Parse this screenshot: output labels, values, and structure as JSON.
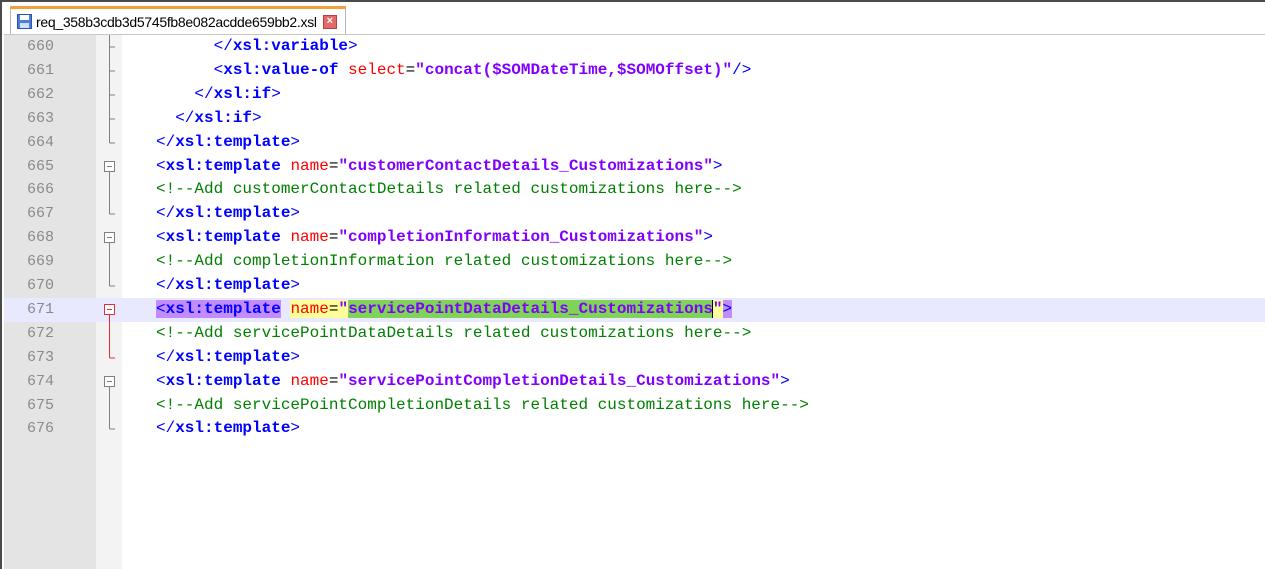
{
  "tab": {
    "filename": "req_358b3cdb3d5745fb8e082acdde659bb2.xsl"
  },
  "icons": {
    "file": "save-file-icon",
    "close": "close-icon",
    "fold_open": "fold-minus-icon"
  },
  "colors": {
    "tab_accent": "#f2a13a",
    "current_line": "#e8e8ff",
    "selection": "#7fd356",
    "tag_match": "#c28cff"
  },
  "lines": [
    {
      "num": "660",
      "indent": "      ",
      "parts": [
        [
          "t-tag",
          "&lt;/"
        ],
        [
          "t-el",
          "xsl:variable"
        ],
        [
          "t-tag",
          "&gt;"
        ]
      ]
    },
    {
      "num": "661",
      "indent": "      ",
      "parts": []
    },
    {
      "num": "662",
      "indent": "    ",
      "parts": []
    },
    {
      "num": "663",
      "indent": "  ",
      "parts": []
    },
    {
      "num": "664",
      "indent": "",
      "parts": []
    },
    {
      "num": "665",
      "indent": "",
      "parts": []
    },
    {
      "num": "666",
      "indent": "",
      "parts": []
    },
    {
      "num": "667",
      "indent": "",
      "parts": []
    },
    {
      "num": "668",
      "indent": "",
      "parts": []
    },
    {
      "num": "669",
      "indent": "",
      "parts": []
    },
    {
      "num": "670",
      "indent": "",
      "parts": []
    },
    {
      "num": "671",
      "indent": "",
      "parts": []
    },
    {
      "num": "672",
      "indent": "",
      "parts": []
    },
    {
      "num": "673",
      "indent": "",
      "parts": []
    },
    {
      "num": "674",
      "indent": "",
      "parts": []
    },
    {
      "num": "675",
      "indent": "",
      "parts": []
    },
    {
      "num": "676",
      "indent": "",
      "parts": []
    }
  ],
  "code": {
    "l660": "      </xsl:variable>",
    "l661": "      <xsl:value-of select=\"concat($SOMDateTime,$SOMOffset)\"/>",
    "l662": "    </xsl:if>",
    "l663": "  </xsl:if>",
    "l664": "</xsl:template>",
    "l665": "<xsl:template name=\"customerContactDetails_Customizations\">",
    "l666": "<!--Add customerContactDetails related customizations here-->",
    "l667": "</xsl:template>",
    "l668": "<xsl:template name=\"completionInformation_Customizations\">",
    "l669": "<!--Add completionInformation related customizations here-->",
    "l670": "</xsl:template>",
    "l671": "<xsl:template name=\"servicePointDataDetails_Customizations\">",
    "l672": "<!--Add servicePointDataDetails related customizations here-->",
    "l673": "</xsl:template>",
    "l674": "<xsl:template name=\"servicePointCompletionDetails_Customizations\">",
    "l675": "<!--Add servicePointCompletionDetails related customizations here-->",
    "l676": "</xsl:template>"
  },
  "current_line": "671"
}
